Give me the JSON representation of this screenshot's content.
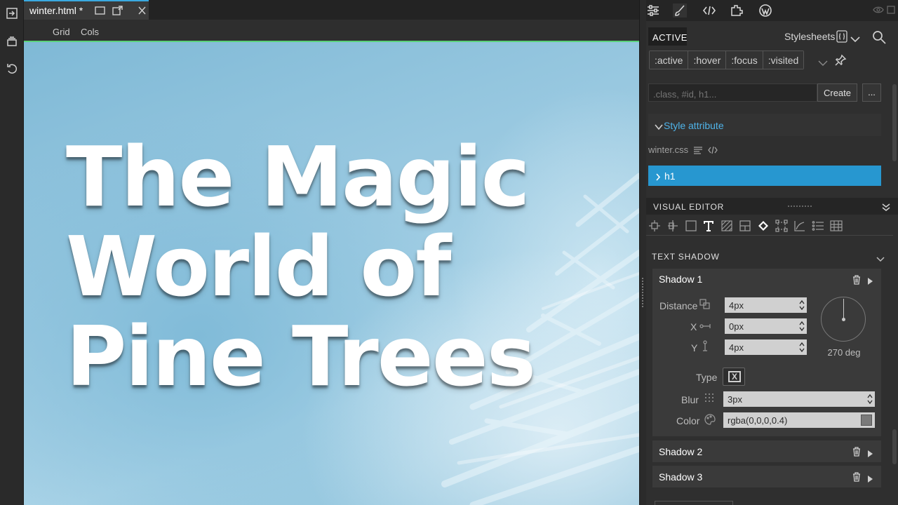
{
  "tab": {
    "label": "winter.html *"
  },
  "toolbar": {
    "grid": "Grid",
    "cols": "Cols"
  },
  "canvas": {
    "title": "The Magic World of Pine Trees"
  },
  "panel": {
    "active_label": "ACTIVE",
    "stylesheets_label": "Stylesheets",
    "pseudo_classes": [
      ":active",
      ":hover",
      ":focus",
      ":visited"
    ],
    "selector_placeholder": ".class, #id, h1...",
    "create_label": "Create",
    "more_label": "...",
    "style_attribute_label": "Style attribute",
    "stylesheet_name": "winter.css",
    "rule_selector": "h1"
  },
  "visual_editor": {
    "title": "VISUAL EDITOR",
    "section_title": "TEXT SHADOW"
  },
  "shadows": {
    "shadow1": {
      "title": "Shadow 1",
      "distance_label": "Distance",
      "distance_value": "4px",
      "x_label": "X",
      "x_value": "0px",
      "y_label": "Y",
      "y_value": "4px",
      "angle_label": "270 deg",
      "type_label": "Type",
      "type_glyph": "X",
      "blur_label": "Blur",
      "blur_value": "3px",
      "color_label": "Color",
      "color_value": "rgba(0,0,0,0.4)"
    },
    "shadow2": {
      "title": "Shadow 2"
    },
    "shadow3": {
      "title": "Shadow 3"
    }
  },
  "colors": {
    "accent_blue": "#2797d0",
    "link_blue": "#4fb3e8",
    "tab_accent": "#3aa9e0",
    "canvas_border_green": "#5ad17a"
  },
  "icons": [
    "import-icon",
    "layers-icon",
    "undo-icon",
    "window-icon",
    "new-window-icon",
    "close-icon",
    "settings-sliders-icon",
    "brush-icon",
    "code-icon",
    "plugin-icon",
    "wordpress-icon",
    "eye-icon",
    "search-icon",
    "pin-icon",
    "trash-icon",
    "play-icon"
  ]
}
